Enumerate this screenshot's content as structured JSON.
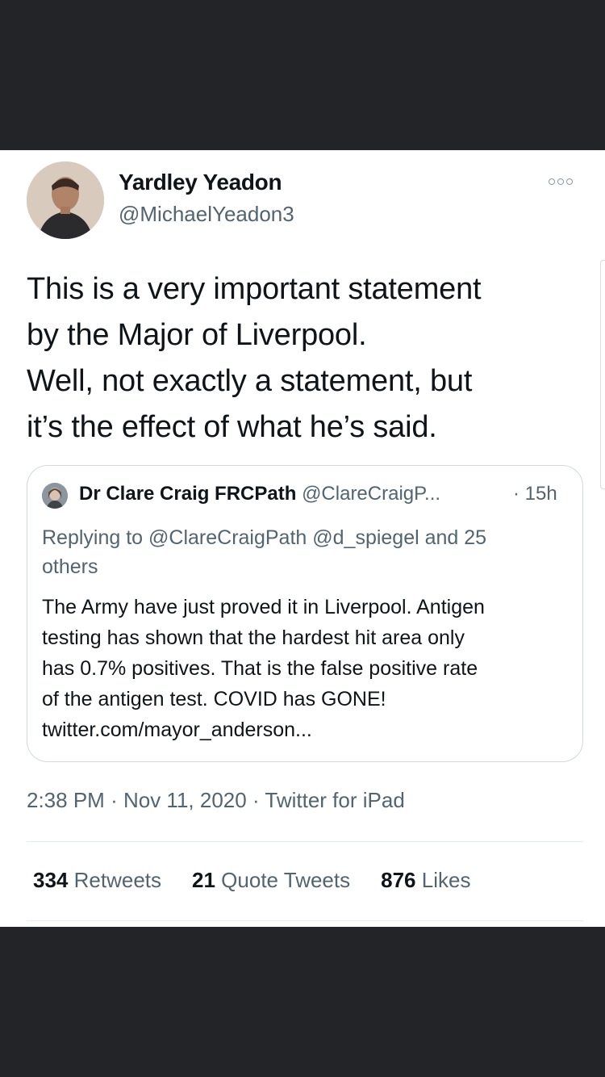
{
  "tweet": {
    "author_name": "Yardley Yeadon",
    "author_handle": "@MichaelYeadon3",
    "text_lines": [
      "This is a very important statement",
      "by the Major of Liverpool.",
      "Well, not exactly a statement, but",
      "it’s the effect of what he’s said."
    ],
    "more_icon": "more-options-icon"
  },
  "quote": {
    "name": "Dr Clare Craig FRCPath",
    "handle": "@ClareCraigP...",
    "time": "· 15h",
    "reply_line1": "Replying to @ClareCraigPath @d_spiegel and 25",
    "reply_line2": "others",
    "body_lines": [
      "The Army have just proved it in Liverpool.  Antigen",
      "testing has shown that the hardest hit area only",
      "has 0.7% positives. That is the false positive rate",
      "of the antigen test. COVID has GONE!",
      "twitter.com/mayor_anderson..."
    ]
  },
  "meta": {
    "time": "2:38 PM",
    "date": "Nov 11, 2020",
    "source": "Twitter for iPad",
    "sep": "·"
  },
  "stats": {
    "retweets_count": "334",
    "retweets_label": "Retweets",
    "quotes_count": "21",
    "quotes_label": "Quote Tweets",
    "likes_count": "876",
    "likes_label": "Likes"
  }
}
